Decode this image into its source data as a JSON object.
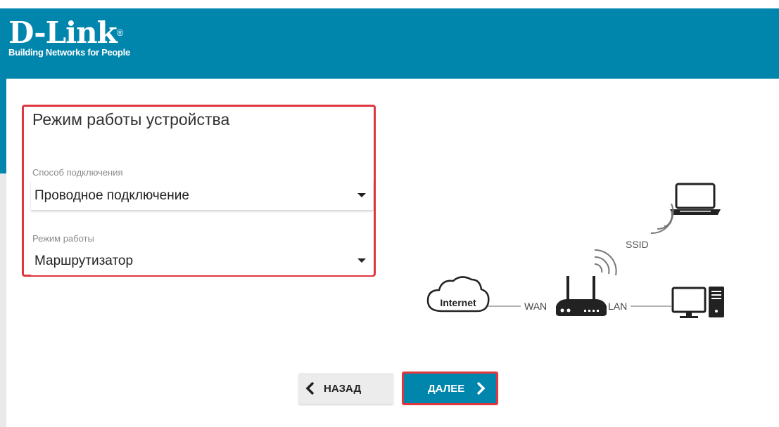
{
  "brand": {
    "name": "D-Link",
    "tagline": "Building Networks for People",
    "registered": "®",
    "header_color": "#0085ad"
  },
  "panel": {
    "title": "Режим работы устройства",
    "highlight_color": "#e0373e",
    "connection": {
      "label": "Способ подключения",
      "value": "Проводное подключение"
    },
    "mode": {
      "label": "Режим работы",
      "value": "Маршрутизатор"
    }
  },
  "diagram": {
    "internet": "Internet",
    "wan": "WAN",
    "lan": "LAN",
    "ssid": "SSID"
  },
  "buttons": {
    "back": "НАЗАД",
    "next": "ДАЛЕЕ"
  },
  "icons": {
    "back": "chevron-left-icon",
    "next": "chevron-right-icon",
    "select": "caret-down-icon"
  }
}
